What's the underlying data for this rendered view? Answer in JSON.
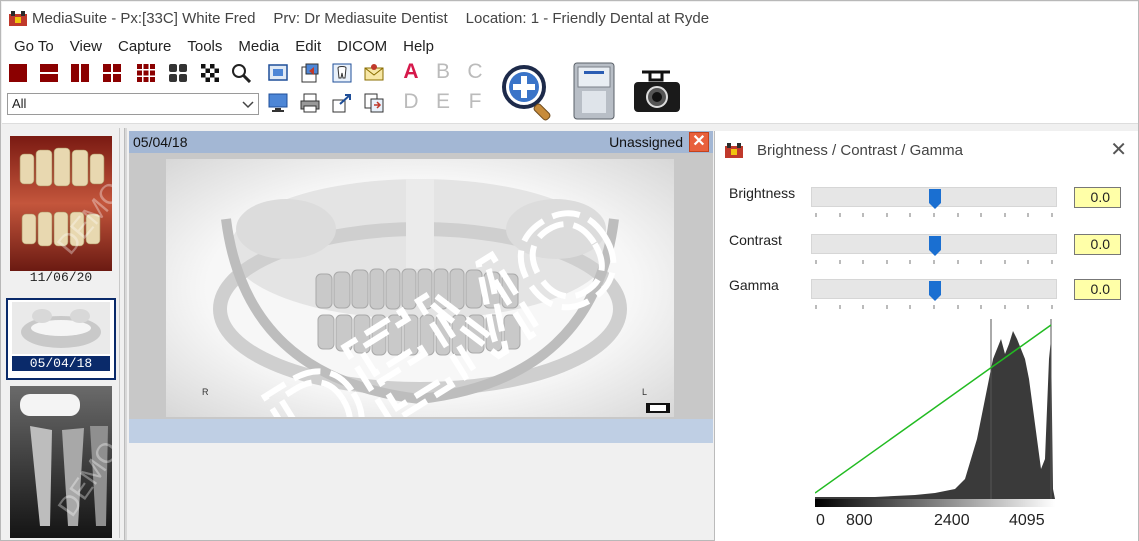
{
  "titlebar": {
    "app_name": "MediaSuite - Px:[33C] White Fred",
    "provider": "Prv: Dr Mediasuite Dentist",
    "location": "Location: 1 -  Friendly Dental at Ryde"
  },
  "menu": [
    "Go To",
    "View",
    "Capture",
    "Tools",
    "Media",
    "Edit",
    "DICOM",
    "Help"
  ],
  "toolbar": {
    "letters_top": [
      "A",
      "B",
      "C"
    ],
    "letters_bottom": [
      "D",
      "E",
      "F"
    ],
    "filter_value": "All"
  },
  "thumbnails": [
    {
      "date": "11/06/20",
      "selected": false
    },
    {
      "date": "05/04/18",
      "selected": true
    },
    {
      "date": "",
      "selected": false
    }
  ],
  "viewer": {
    "date": "05/04/18",
    "status": "Unassigned",
    "close_glyph": "✕",
    "xray_left_marker": "R",
    "xray_right_marker": "L",
    "watermark": "DEMO"
  },
  "panel": {
    "title": "Brightness / Contrast / Gamma",
    "close_glyph": "✕",
    "brightness_label": "Brightness",
    "brightness_value": "0.0",
    "contrast_label": "Contrast",
    "contrast_value": "0.0",
    "gamma_label": "Gamma",
    "gamma_value": "0.0",
    "histogram_axis": [
      "0",
      "800",
      "2400",
      "4095"
    ]
  },
  "colors": {
    "accent_red": "#8b0000",
    "header_blue": "#a3b7d4",
    "value_yellow": "#ffffa8",
    "slider_blue": "#1a6fd1",
    "curve_green": "#22bb22"
  }
}
